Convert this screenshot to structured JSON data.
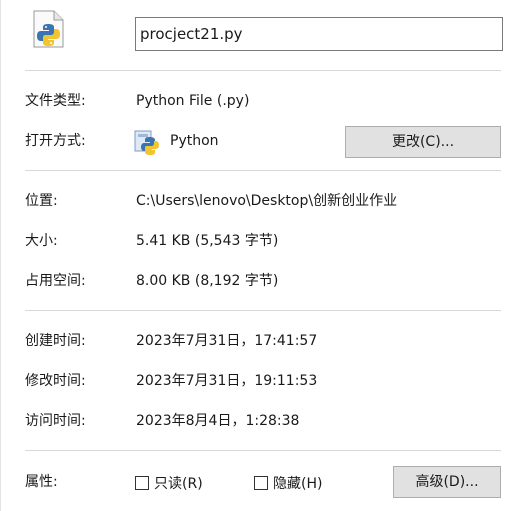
{
  "general": {
    "file_name": "procject21.py",
    "icon": "python-file-icon",
    "type_label": "文件类型:",
    "type_value": "Python File (.py)",
    "opens_with_label": "打开方式:",
    "opens_with_icon": "python-app-icon",
    "opens_with_value": "Python",
    "change_button": "更改(C)...",
    "location_label": "位置:",
    "location_value": "C:\\Users\\lenovo\\Desktop\\创新创业作业",
    "size_label": "大小:",
    "size_value": "5.41 KB (5,543 字节)",
    "size_on_disk_label": "占用空间:",
    "size_on_disk_value": "8.00 KB (8,192 字节)",
    "created_label": "创建时间:",
    "created_value": "2023年7月31日，17:41:57",
    "modified_label": "修改时间:",
    "modified_value": "2023年7月31日，19:11:53",
    "accessed_label": "访问时间:",
    "accessed_value": "2023年8月4日，1:28:38",
    "attributes_label": "属性:",
    "readonly_label": "只读(R)",
    "readonly_checked": false,
    "hidden_label": "隐藏(H)",
    "hidden_checked": false,
    "advanced_button": "高级(D)..."
  }
}
